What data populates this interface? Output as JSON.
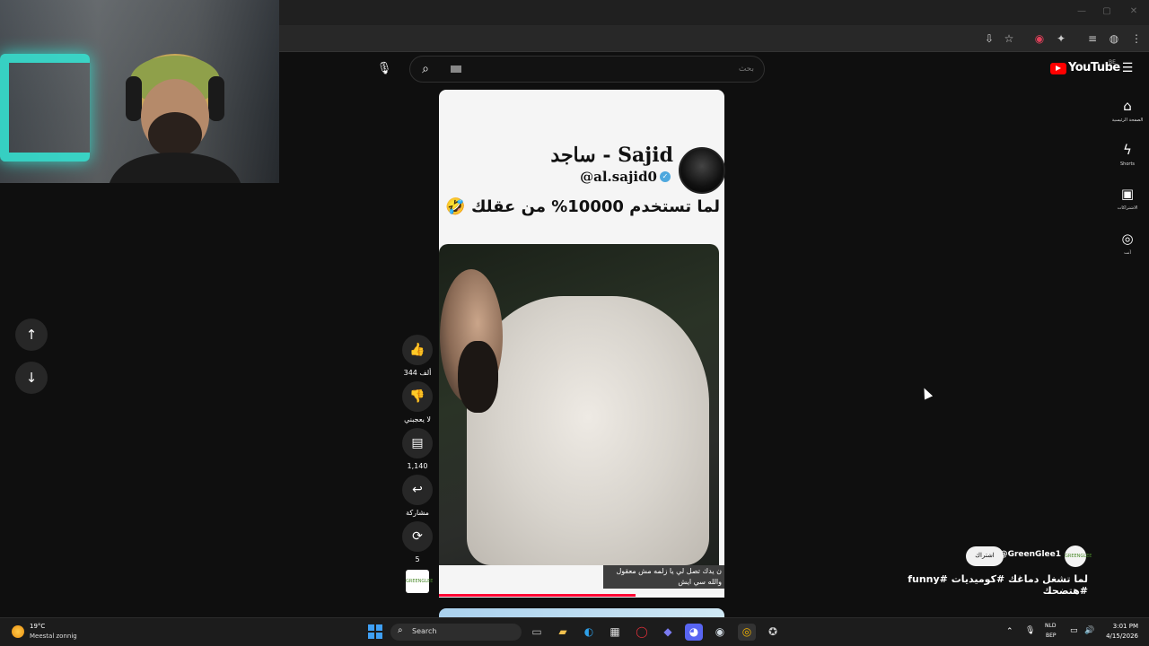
{
  "search": {
    "placeholder": "بحث"
  },
  "youtube": {
    "logo_text": "YouTube",
    "region": "BE"
  },
  "sidebar": {
    "items": [
      {
        "label": "الصفحة الرئيسية",
        "icon": "home-icon"
      },
      {
        "label": "Shorts",
        "icon": "shorts-icon"
      },
      {
        "label": "الاشتراكات",
        "icon": "subscriptions-icon"
      },
      {
        "label": "أنت",
        "icon": "you-icon"
      }
    ]
  },
  "short": {
    "channel_display_name": "ساجد - Sajid",
    "handle": "@al.sajid0",
    "caption": "لما تستخدم 10000% من عقلك 🤣",
    "subtitle": "ن يدك تصل لي يا زلمه مش معقول والله سي ايش",
    "progress_fraction": 0.69
  },
  "actions": {
    "likes": "344 ألف",
    "dislike_label": "لا يعجبني",
    "comments": "1,140",
    "share_label": "مشاركة",
    "remix_count": "5",
    "thumb_label": "GREENGLEE"
  },
  "channel": {
    "name": "@GreenGlee1",
    "subscribe_label": "اشتراك",
    "avatar_label": "GREENGLEE"
  },
  "title": "لما تشغل دماغك #كوميديات #funny #هتضحك",
  "taskbar": {
    "weather_temp": "19°C",
    "weather_desc": "Meestal zonnig",
    "search_label": "Search",
    "lang_line1": "NLD",
    "lang_line2": "BEP",
    "time": "3:01 PM",
    "date": "4/15/2026"
  },
  "colors": {
    "accent": "#ff0000",
    "progress": "#ff0033",
    "background": "#0f0f0f"
  }
}
